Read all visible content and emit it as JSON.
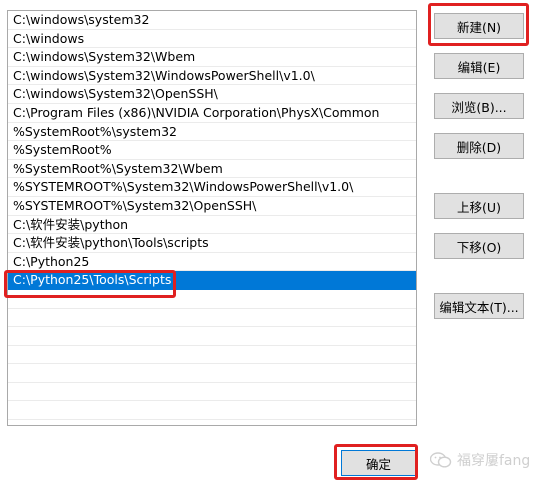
{
  "path_list": {
    "items": [
      "C:\\windows\\system32",
      "C:\\windows",
      "C:\\windows\\System32\\Wbem",
      "C:\\windows\\System32\\WindowsPowerShell\\v1.0\\",
      "C:\\windows\\System32\\OpenSSH\\",
      "C:\\Program Files (x86)\\NVIDIA Corporation\\PhysX\\Common",
      "%SystemRoot%\\system32",
      "%SystemRoot%",
      "%SystemRoot%\\System32\\Wbem",
      "%SYSTEMROOT%\\System32\\WindowsPowerShell\\v1.0\\",
      "%SYSTEMROOT%\\System32\\OpenSSH\\",
      "C:\\软件安装\\python",
      "C:\\软件安装\\python\\Tools\\scripts",
      "C:\\Python25",
      "C:\\Python25\\Tools\\Scripts"
    ],
    "selected_index": 14,
    "empty_rows": 7
  },
  "buttons": {
    "new": "新建(N)",
    "edit": "编辑(E)",
    "browse": "浏览(B)...",
    "delete": "删除(D)",
    "move_up": "上移(U)",
    "move_down": "下移(O)",
    "edit_text": "编辑文本(T)...",
    "ok": "确定"
  },
  "watermark": {
    "text": "福穿屢fang"
  },
  "colors": {
    "selection": "#0078d7",
    "highlight": "#e02020"
  }
}
